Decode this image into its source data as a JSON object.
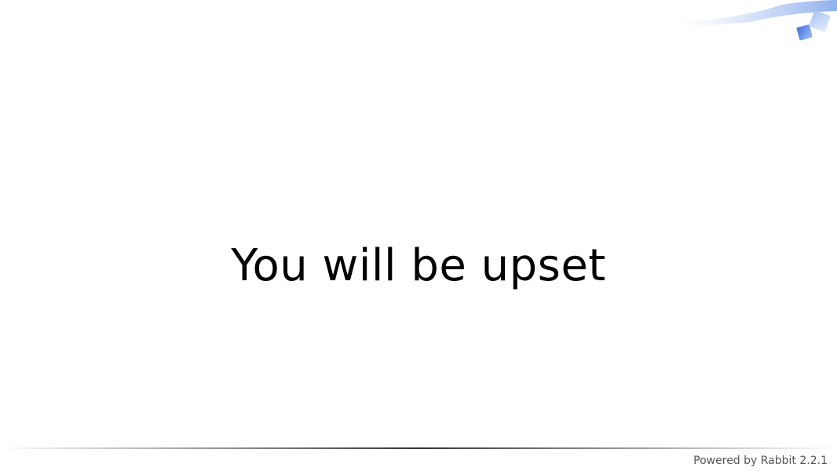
{
  "slide": {
    "title": "You will be upset"
  },
  "footer": {
    "powered_by": "Powered by Rabbit 2.2.1"
  },
  "colors": {
    "background": "#ffffff",
    "title": "#000000",
    "footer_text": "#555555",
    "accent_blue": "#5b86e5"
  },
  "icons": {
    "corner": "blue-swoosh-with-squares-icon"
  }
}
